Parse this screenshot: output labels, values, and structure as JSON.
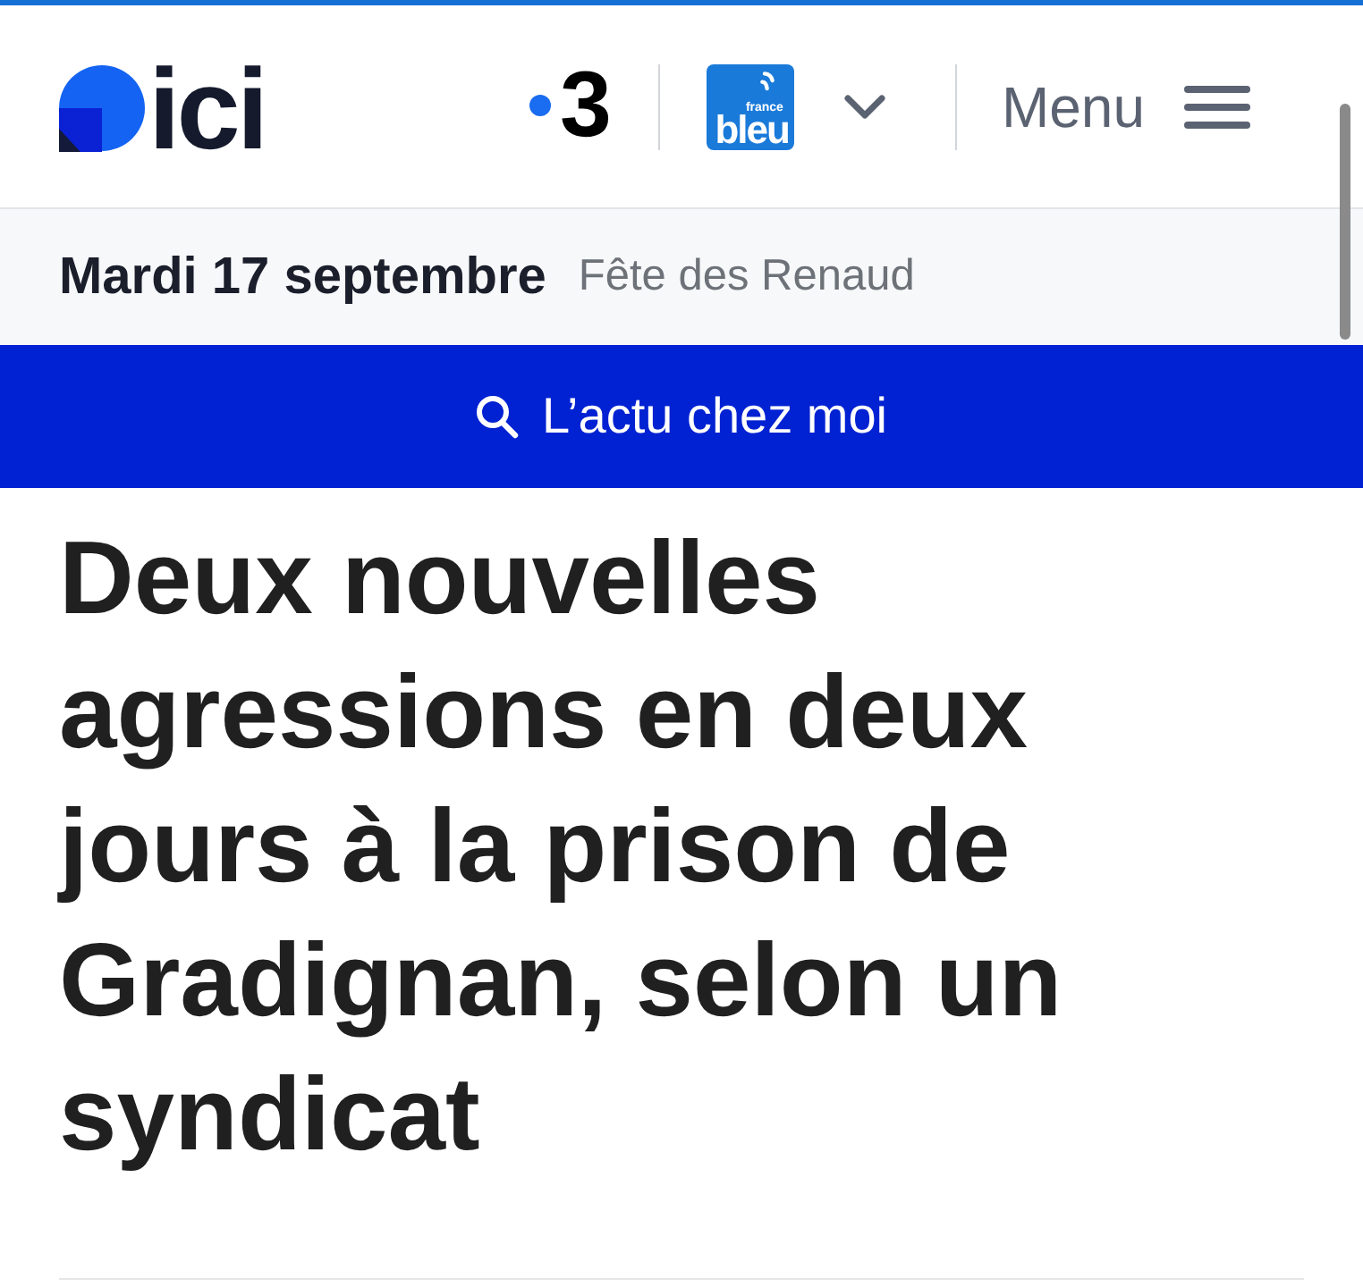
{
  "header": {
    "logo": {
      "text": "ici"
    },
    "channels": [
      {
        "kind": "tv",
        "text": "3"
      },
      {
        "kind": "radio",
        "text_small": "france",
        "text": "bleu"
      }
    ],
    "menu": {
      "label": "Menu"
    }
  },
  "date_bar": {
    "date": "Mardi 17 septembre",
    "saint": "Fête des Renaud"
  },
  "local_news": {
    "label": "L’actu chez moi"
  },
  "article": {
    "headline": "Deux nouvelles agressions en deux jours à la prison de Gradignan, selon un syndicat"
  }
}
